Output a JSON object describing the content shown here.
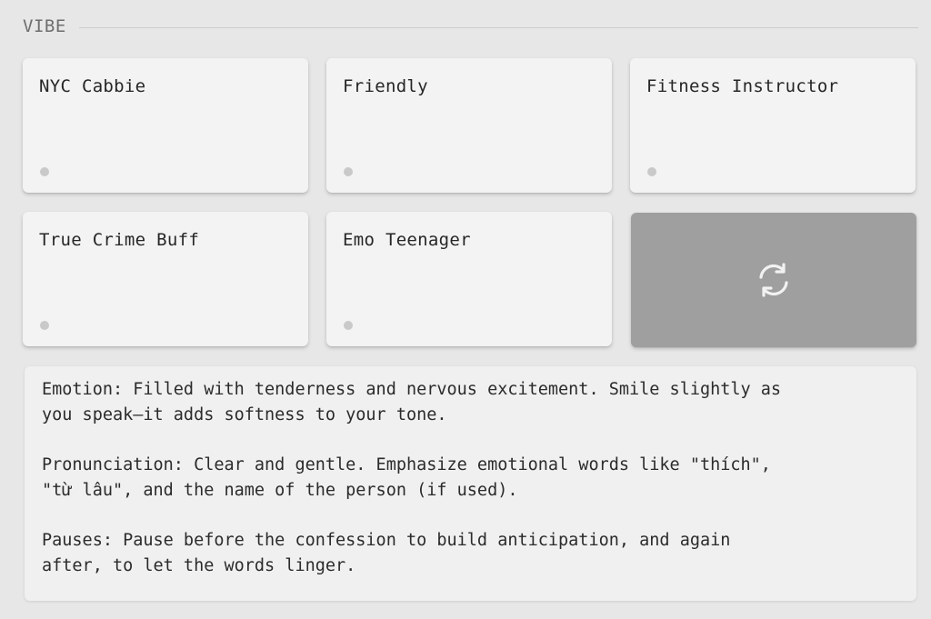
{
  "section": {
    "title": "VIBE"
  },
  "vibes": [
    {
      "label": "NYC Cabbie"
    },
    {
      "label": "Friendly"
    },
    {
      "label": "Fitness Instructor"
    },
    {
      "label": "True Crime Buff"
    },
    {
      "label": "Emo Teenager"
    }
  ],
  "refresh": {
    "icon": "refresh-icon"
  },
  "description": {
    "paragraphs": [
      "Emotion: Filled with tenderness and nervous excitement. Smile slightly as\nyou speak—it adds softness to your tone.",
      "Pronunciation: Clear and gentle. Emphasize emotional words like \"thích\",\n\"từ lâu\", and the name of the person (if used).",
      "Pauses: Pause before the confession to build anticipation, and again\nafter, to let the words linger."
    ]
  },
  "colors": {
    "background": "#e7e7e7",
    "card": "#f3f3f3",
    "refresh_card": "#9f9f9f",
    "text": "#262626"
  }
}
